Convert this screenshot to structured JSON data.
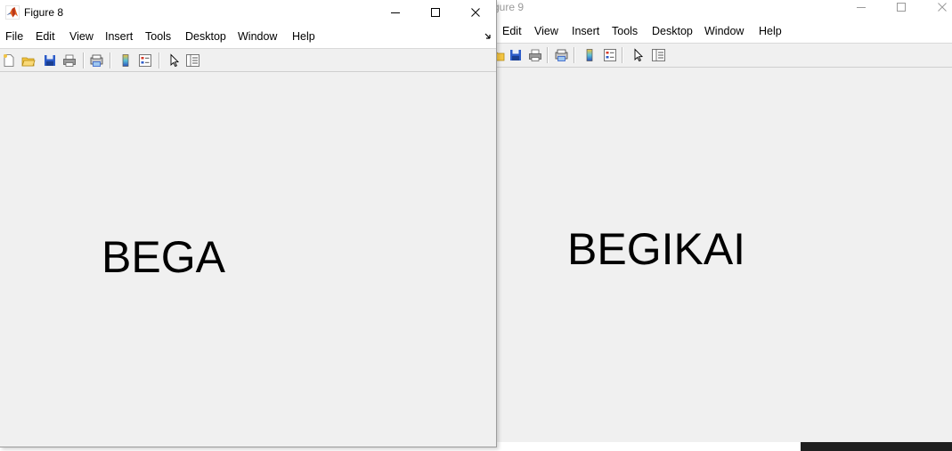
{
  "figure_front": {
    "title": "Figure 8",
    "menu": [
      "File",
      "Edit",
      "View",
      "Insert",
      "Tools",
      "Desktop",
      "Window",
      "Help"
    ],
    "label_text": "BEGA",
    "toolbar_icons": [
      "new-figure-icon",
      "open-file-icon",
      "save-icon",
      "print-icon",
      "print-preview-icon",
      "colorbar-icon",
      "legend-icon",
      "pointer-icon",
      "property-inspector-icon"
    ],
    "window_controls": [
      "minimize-icon",
      "maximize-icon",
      "close-icon"
    ]
  },
  "figure_back": {
    "title": "gure 9",
    "menu": [
      "Edit",
      "View",
      "Insert",
      "Tools",
      "Desktop",
      "Window",
      "Help"
    ],
    "label_text": "BEGIKAI",
    "toolbar_icons": [
      "open-file-icon",
      "save-icon",
      "print-icon",
      "print-preview-icon",
      "colorbar-icon",
      "legend-icon",
      "pointer-icon",
      "property-inspector-icon"
    ],
    "window_controls": [
      "minimize-icon",
      "maximize-icon",
      "close-icon"
    ]
  },
  "colors": {
    "figure_background": "#f0f0f0",
    "titlebar_background": "#ffffff",
    "text": "#000000",
    "inactive_title_text": "#9a9a9a",
    "taskbar": "#1f1f1f"
  }
}
